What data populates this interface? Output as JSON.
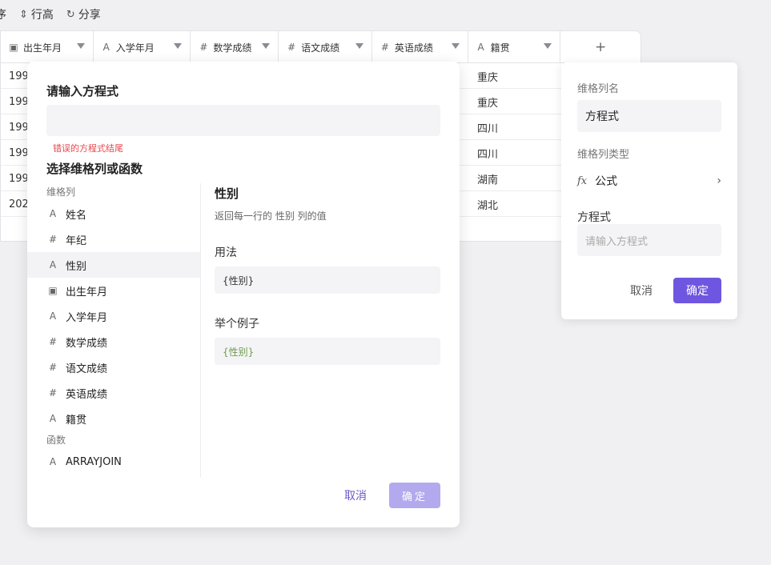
{
  "toolbar": {
    "sort_label": "序",
    "row_height_icon": "row-height-icon",
    "row_height_label": "行高",
    "share_icon": "share-icon",
    "share_label": "分享"
  },
  "table": {
    "columns": [
      {
        "icon": "date-icon",
        "glyph": "▣",
        "label": "出生年月"
      },
      {
        "icon": "text-icon",
        "glyph": "A",
        "label": "入学年月"
      },
      {
        "icon": "number-icon",
        "glyph": "#",
        "label": "数学成绩"
      },
      {
        "icon": "number-icon",
        "glyph": "#",
        "label": "语文成绩"
      },
      {
        "icon": "number-icon",
        "glyph": "#",
        "label": "英语成绩"
      },
      {
        "icon": "text-icon",
        "glyph": "A",
        "label": "籍贯"
      }
    ],
    "add_column_label": "+",
    "rows": [
      {
        "birth": "199",
        "native": "重庆"
      },
      {
        "birth": "199",
        "native": "重庆"
      },
      {
        "birth": "199",
        "native": "四川"
      },
      {
        "birth": "199",
        "native": "四川"
      },
      {
        "birth": "199",
        "native": "湖南"
      },
      {
        "birth": "202",
        "native": "湖北"
      }
    ]
  },
  "dialog": {
    "title": "请输入方程式",
    "input_value": "",
    "error": "错误的方程式结尾",
    "select_title": "选择维格列或函数",
    "columns_section": "维格列",
    "column_items": [
      {
        "glyph": "A",
        "label": "姓名",
        "selected": false
      },
      {
        "glyph": "#",
        "label": "年纪",
        "selected": false
      },
      {
        "glyph": "A",
        "label": "性别",
        "selected": true
      },
      {
        "glyph": "▣",
        "label": "出生年月",
        "selected": false
      },
      {
        "glyph": "A",
        "label": "入学年月",
        "selected": false
      },
      {
        "glyph": "#",
        "label": "数学成绩",
        "selected": false
      },
      {
        "glyph": "#",
        "label": "语文成绩",
        "selected": false
      },
      {
        "glyph": "#",
        "label": "英语成绩",
        "selected": false
      },
      {
        "glyph": "A",
        "label": "籍贯",
        "selected": false
      }
    ],
    "functions_section": "函数",
    "function_items": [
      {
        "glyph": "A",
        "label": "ARRAYJOIN"
      }
    ],
    "detail": {
      "name": "性别",
      "description": "返回每一行的 性别 列的值",
      "usage_title": "用法",
      "usage_code": "{性别}",
      "example_title": "举个例子",
      "example_code": "{性别}"
    },
    "cancel_label": "取消",
    "confirm_label": "确定"
  },
  "panel": {
    "name_label": "维格列名",
    "name_value": "方程式",
    "type_label": "维格列类型",
    "type_value": "公式",
    "formula_label": "方程式",
    "formula_placeholder": "请输入方程式",
    "cancel_label": "取消",
    "confirm_label": "确定"
  },
  "colors": {
    "accent": "#6f56e0",
    "accent_disabled": "#b3a9ee",
    "error": "#e5484d",
    "example_code": "#6f9a4f"
  }
}
